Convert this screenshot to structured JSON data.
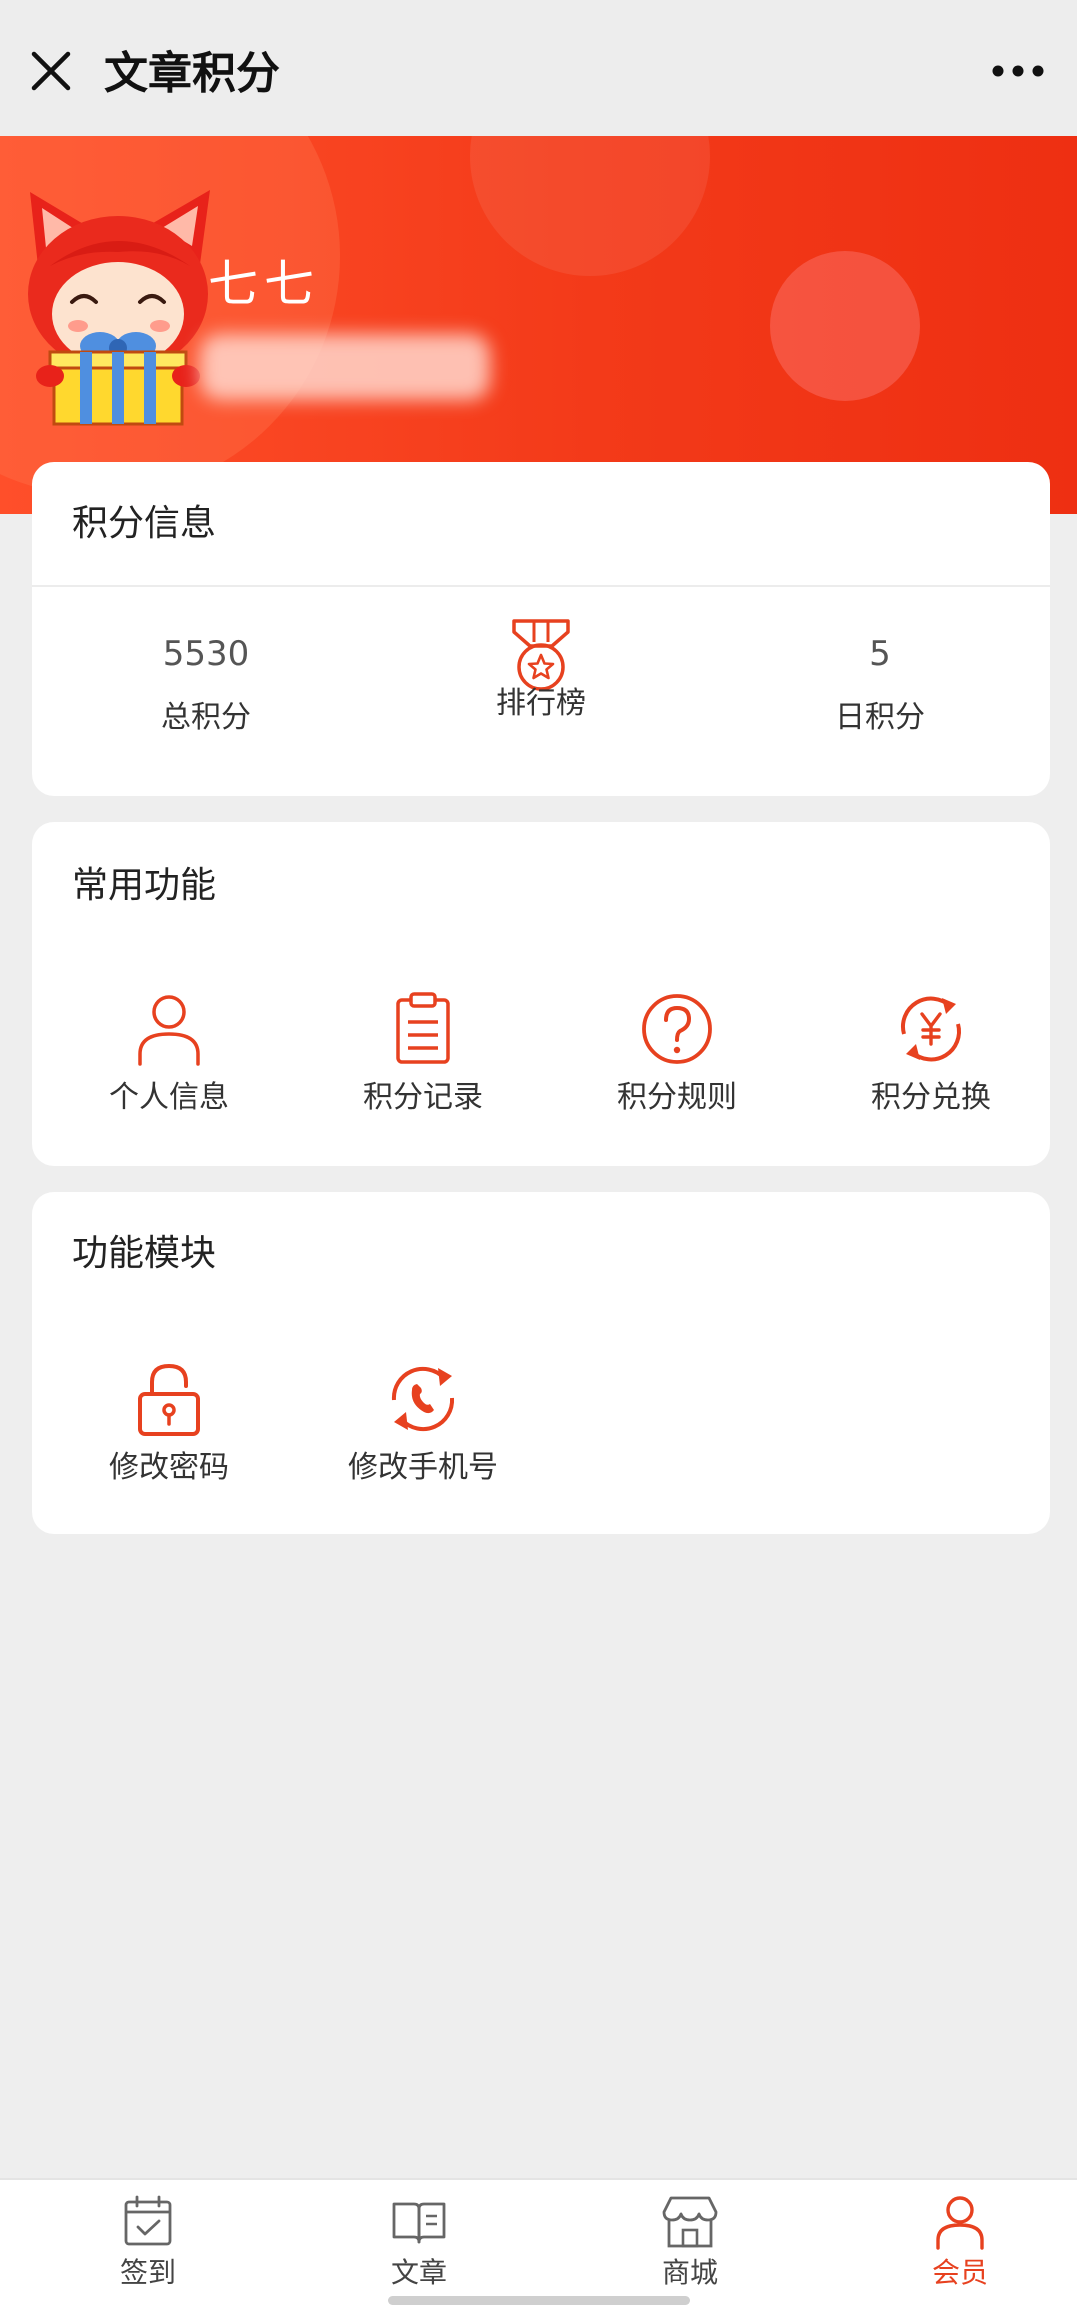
{
  "header": {
    "title": "文章积分",
    "close_icon": "close-icon",
    "more_icon": "more-dots-icon"
  },
  "profile": {
    "name": "七七",
    "avatar_icon": "fox-avatar-icon"
  },
  "points_card": {
    "title": "积分信息",
    "total": {
      "value": "5530",
      "label": "总积分"
    },
    "ranking": {
      "label": "排行榜",
      "icon": "medal-icon"
    },
    "daily": {
      "value": "5",
      "label": "日积分"
    }
  },
  "common_functions": {
    "title": "常用功能",
    "items": [
      {
        "label": "个人信息",
        "icon": "person-icon"
      },
      {
        "label": "积分记录",
        "icon": "clipboard-icon"
      },
      {
        "label": "积分规则",
        "icon": "question-icon"
      },
      {
        "label": "积分兑换",
        "icon": "exchange-yen-icon"
      }
    ]
  },
  "modules": {
    "title": "功能模块",
    "items": [
      {
        "label": "修改密码",
        "icon": "lock-icon"
      },
      {
        "label": "修改手机号",
        "icon": "refresh-phone-icon"
      }
    ]
  },
  "tabbar": {
    "items": [
      {
        "label": "签到",
        "icon": "calendar-check-icon"
      },
      {
        "label": "文章",
        "icon": "book-icon"
      },
      {
        "label": "商城",
        "icon": "store-icon"
      },
      {
        "label": "会员",
        "icon": "member-icon",
        "active": true
      }
    ]
  },
  "colors": {
    "accent": "#e7411f",
    "banner": "#f33a19",
    "background": "#eeeeee"
  }
}
